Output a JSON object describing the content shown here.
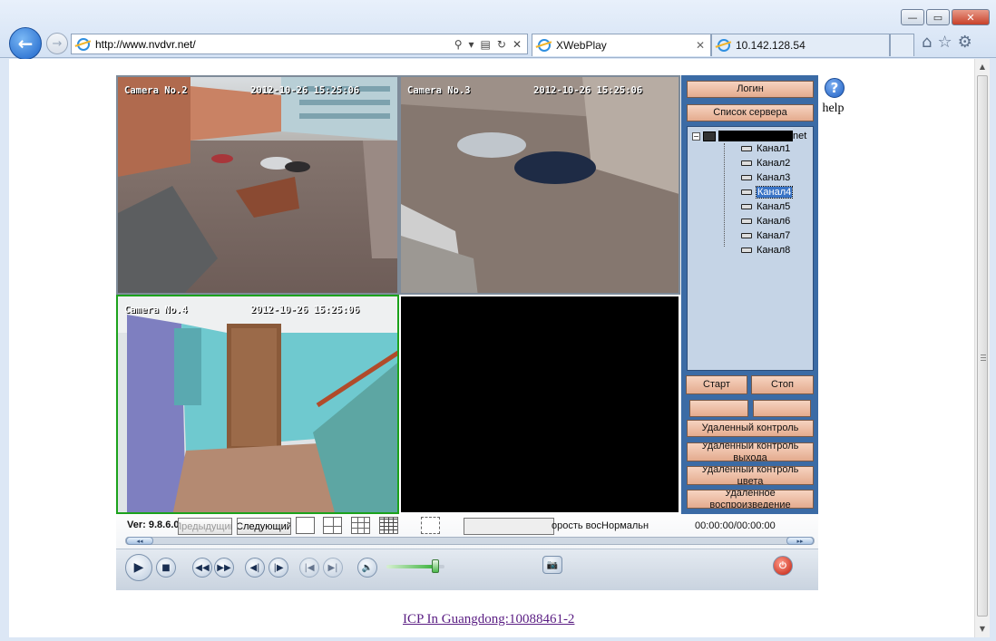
{
  "browser": {
    "address_url": "http://www.nvdvr.net/",
    "tabs": [
      {
        "label": "XWebPlay"
      },
      {
        "label": "10.142.128.54"
      }
    ],
    "window_buttons": {
      "minimize": "—",
      "restore": "▭",
      "close": "✕"
    }
  },
  "help": {
    "label": "help"
  },
  "cameras": [
    {
      "label": "Camera No.2",
      "timestamp": "2012-10-26 15:25:06"
    },
    {
      "label": "Camera No.3",
      "timestamp": "2012-10-26 15:25:06"
    },
    {
      "label": "Camera No.4",
      "timestamp": "2012-10-26 15:25:06"
    }
  ],
  "panel": {
    "login": "Логин",
    "server_list": "Список сервера",
    "server_node_suffix": "net",
    "channels": [
      "Канал1",
      "Канал2",
      "Канал3",
      "Канал4",
      "Канал5",
      "Канал6",
      "Канал7",
      "Канал8"
    ],
    "selected_channel": "Канал4",
    "start": "Старт",
    "stop": "Стоп",
    "remote_control": "Удаленный контроль",
    "remote_output": "Удаленный контроль выхода",
    "remote_color": "Удаленный контроль цвета",
    "remote_playback": "Удаленное воспроизведение"
  },
  "controlbar": {
    "version": "Ver: 9.8.6.0",
    "prev": "Предыдущий",
    "next": "Следующий",
    "speed_label": "орость вос",
    "speed_value": "Нормальн",
    "time": "00:00:00/00:00:00",
    "seek_left": "◂◂",
    "seek_right": "▸▸",
    "volume_level": 0.85
  },
  "footer": {
    "link": "ICP In Guangdong:10088461-2"
  }
}
